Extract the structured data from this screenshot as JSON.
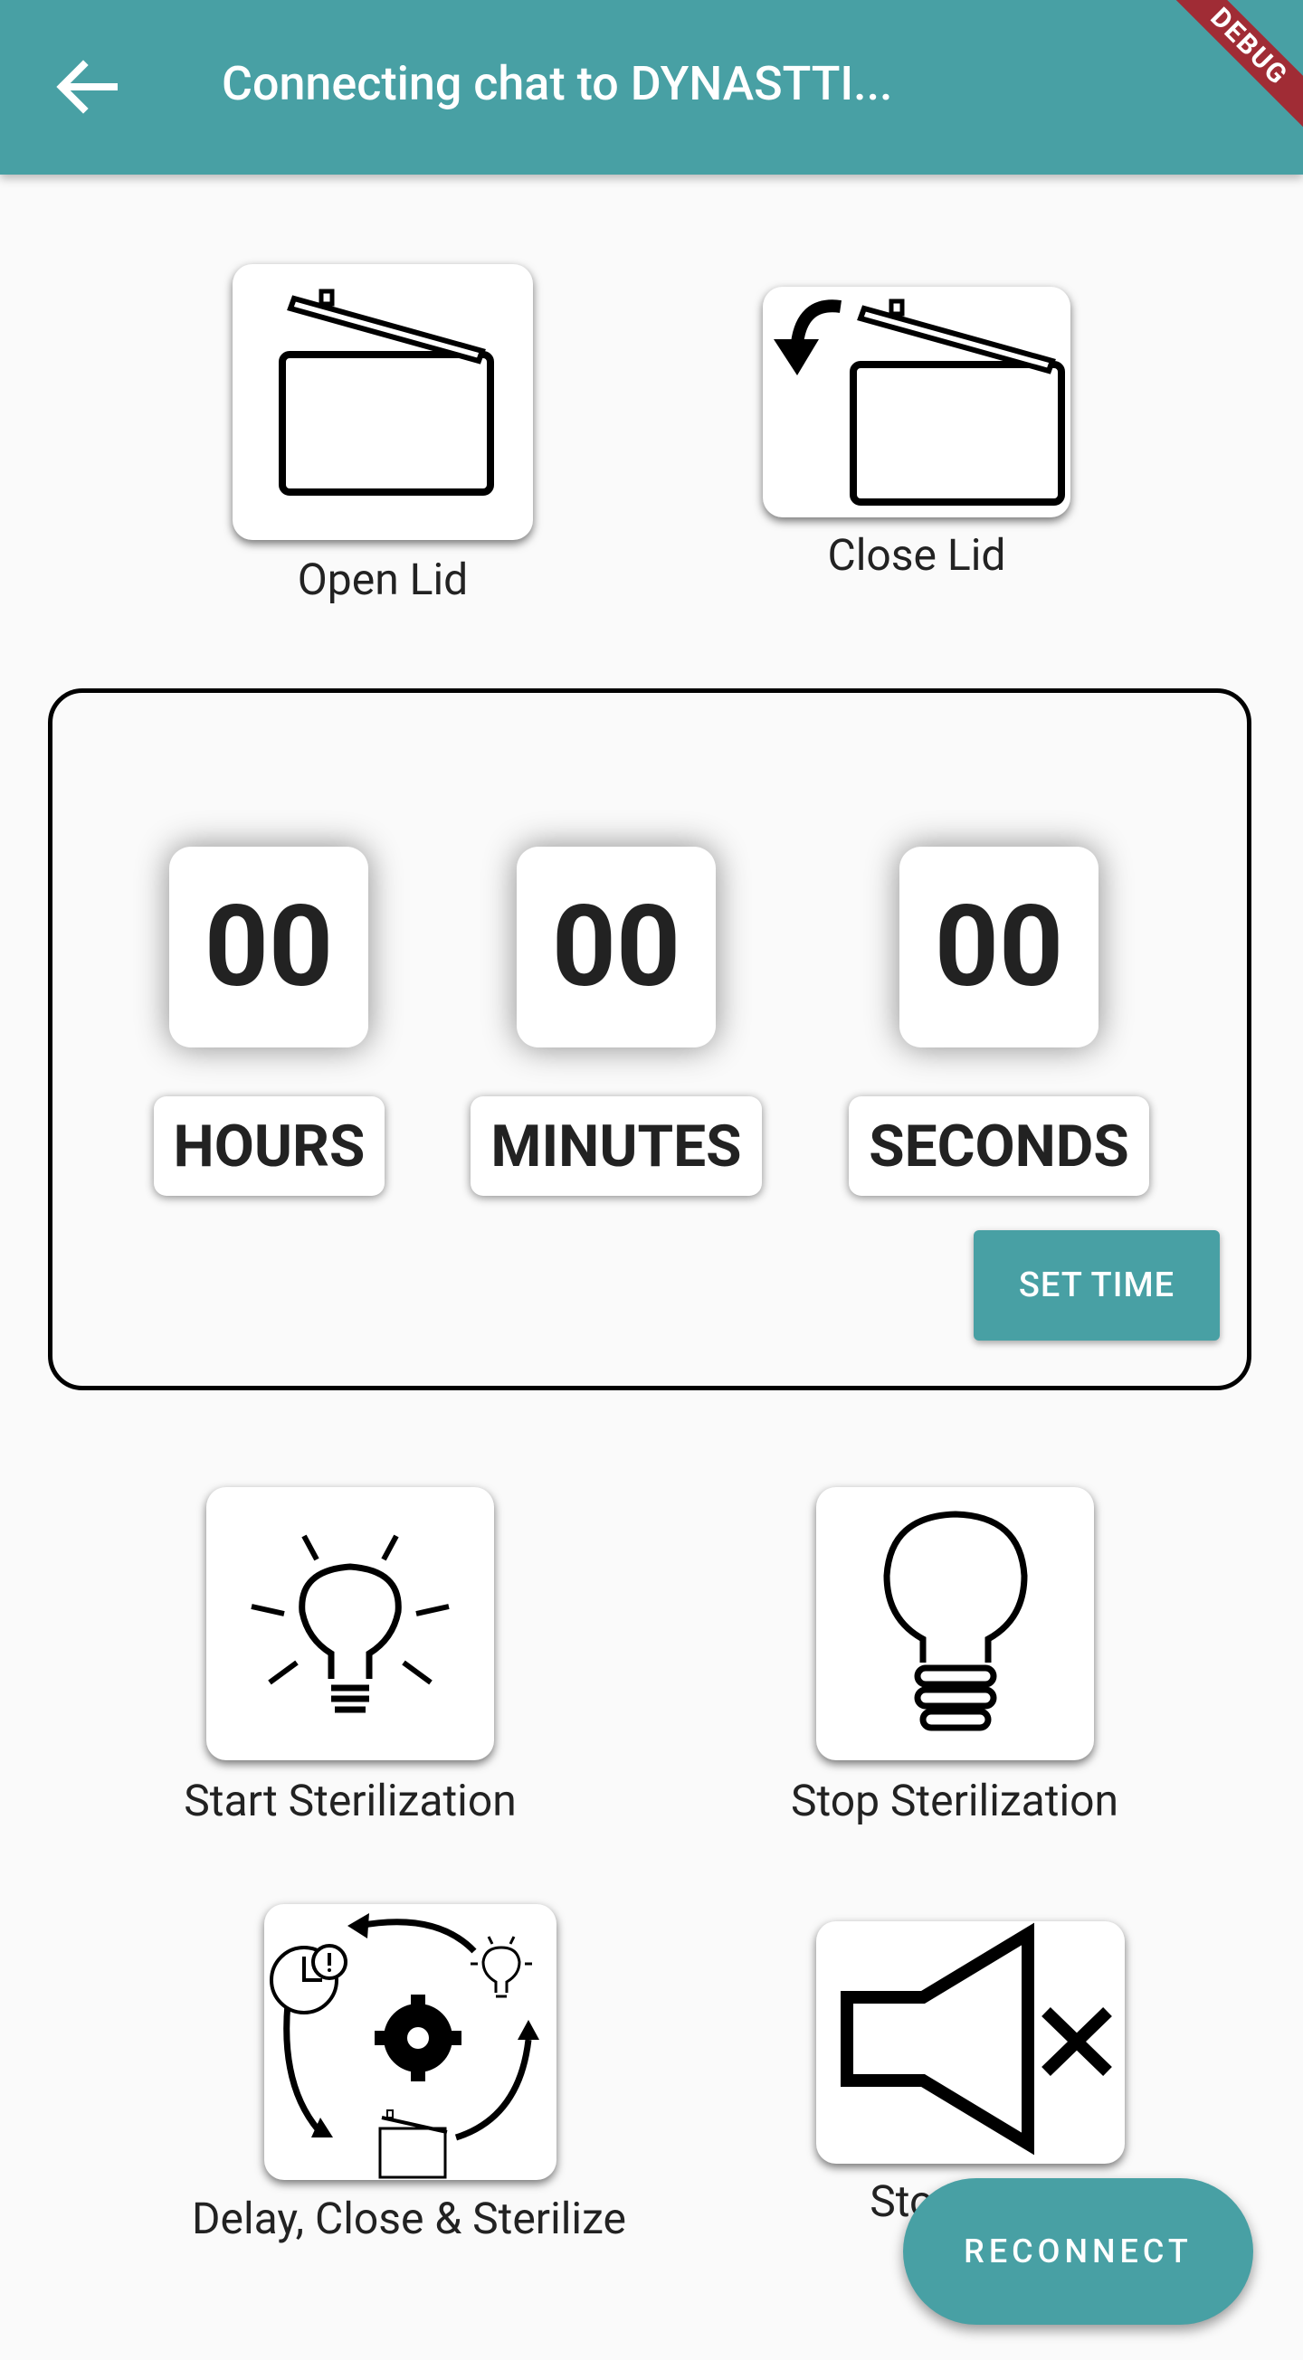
{
  "appbar": {
    "title": "Connecting chat to DYNASTTI...",
    "debug_banner": "DEBUG"
  },
  "lid": {
    "open_label": "Open Lid",
    "close_label": "Close Lid"
  },
  "timer": {
    "hours": "00",
    "minutes": "00",
    "seconds": "00",
    "hours_label": "HOURS",
    "minutes_label": "MINUTES",
    "seconds_label": "SECONDS",
    "set_time_label": "SET TIME"
  },
  "sterilization": {
    "start_label": "Start Sterilization",
    "stop_label": "Stop Sterilization",
    "delay_label": "Delay, Close & Sterilize",
    "mute_label": "Stop Alarm"
  },
  "fab": {
    "reconnect_label": "RECONNECT"
  },
  "colors": {
    "primary": "#48a0a4",
    "debug_banner": "#a02c35",
    "background": "#fafafa"
  }
}
